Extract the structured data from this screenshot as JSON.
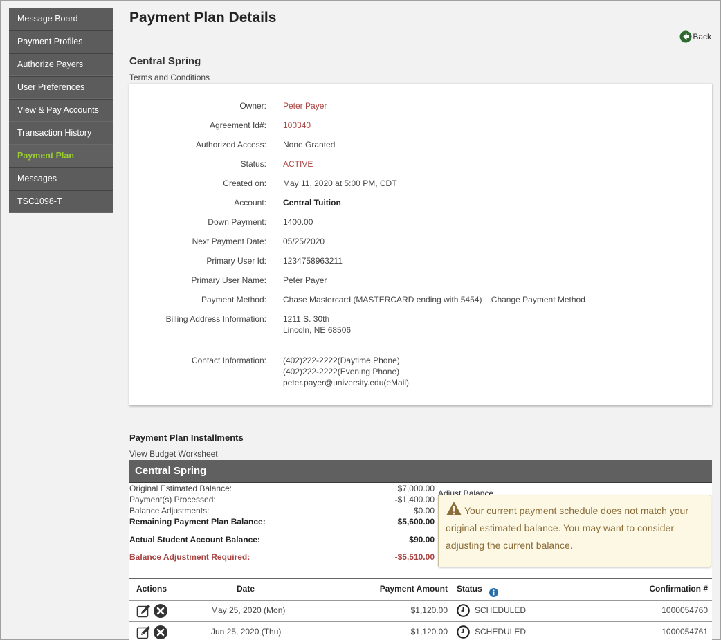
{
  "sidebar": {
    "items": [
      {
        "label": "Message Board",
        "active": false
      },
      {
        "label": "Payment Profiles",
        "active": false
      },
      {
        "label": "Authorize Payers",
        "active": false
      },
      {
        "label": "User Preferences",
        "active": false
      },
      {
        "label": "View & Pay Accounts",
        "active": false
      },
      {
        "label": "Transaction History",
        "active": false
      },
      {
        "label": "Payment Plan",
        "active": true
      },
      {
        "label": "Messages",
        "active": false
      },
      {
        "label": "TSC1098-T",
        "active": false
      }
    ],
    "active_color": "#9acd32"
  },
  "page": {
    "title": "Payment Plan Details",
    "back_label": "Back",
    "plan_name": "Central Spring",
    "terms_link": "Terms and Conditions"
  },
  "details": {
    "owner_label": "Owner:",
    "owner": "Peter Payer",
    "agreement_label": "Agreement Id#:",
    "agreement": "100340",
    "access_label": "Authorized Access:",
    "access": "None Granted",
    "status_label": "Status:",
    "status": "ACTIVE",
    "created_label": "Created on:",
    "created": "May 11, 2020 at 5:00 PM, CDT",
    "account_label": "Account:",
    "account": "Central Tuition",
    "down_label": "Down Payment:",
    "down": "1400.00",
    "next_label": "Next Payment Date:",
    "next": "05/25/2020",
    "user_id_label": "Primary User Id:",
    "user_id": "1234758963211",
    "user_name_label": "Primary User Name:",
    "user_name": "Peter Payer",
    "method_label": "Payment Method:",
    "method": "Chase Mastercard (MASTERCARD ending with 5454)",
    "change_method": "Change Payment Method",
    "billing_label": "Billing Address Information:",
    "billing_line1": "1211 S. 30th",
    "billing_line2": "Lincoln, NE 68506",
    "contact_label": "Contact Information:",
    "contact_day": "(402)222-2222(Daytime Phone)",
    "contact_eve": "(402)222-2222(Evening Phone)",
    "contact_email": "peter.payer@university.edu(eMail)"
  },
  "installments": {
    "title": "Payment Plan Installments",
    "budget_link": "View Budget Worksheet",
    "plan_header": "Central Spring",
    "balances": {
      "original_label": "Original Estimated Balance:",
      "original": "$7,000.00",
      "processed_label": "Payment(s) Processed:",
      "processed": "-$1,400.00",
      "adjust_label": "Balance Adjustments:",
      "adjust": "$0.00",
      "remaining_label": "Remaining Payment Plan Balance:",
      "remaining": "$5,600.00",
      "actual_label": "Actual Student Account Balance:",
      "actual": "$90.00",
      "required_label": "Balance Adjustment Required:",
      "required": "-$5,510.00"
    },
    "adjust_balance_link": "Adjust Balance",
    "alert_text": "Your current payment schedule does not match your original estimated balance. You may want to consider adjusting the current balance.",
    "table": {
      "headers": {
        "actions": "Actions",
        "date": "Date",
        "amount": "Payment Amount",
        "status": "Status",
        "confirmation": "Confirmation #"
      },
      "rows": [
        {
          "date": "May 25, 2020 (Mon)",
          "amount": "$1,120.00",
          "status": "SCHEDULED",
          "confirmation": "1000054760"
        },
        {
          "date": "Jun 25, 2020 (Thu)",
          "amount": "$1,120.00",
          "status": "SCHEDULED",
          "confirmation": "1000054761"
        }
      ]
    }
  }
}
